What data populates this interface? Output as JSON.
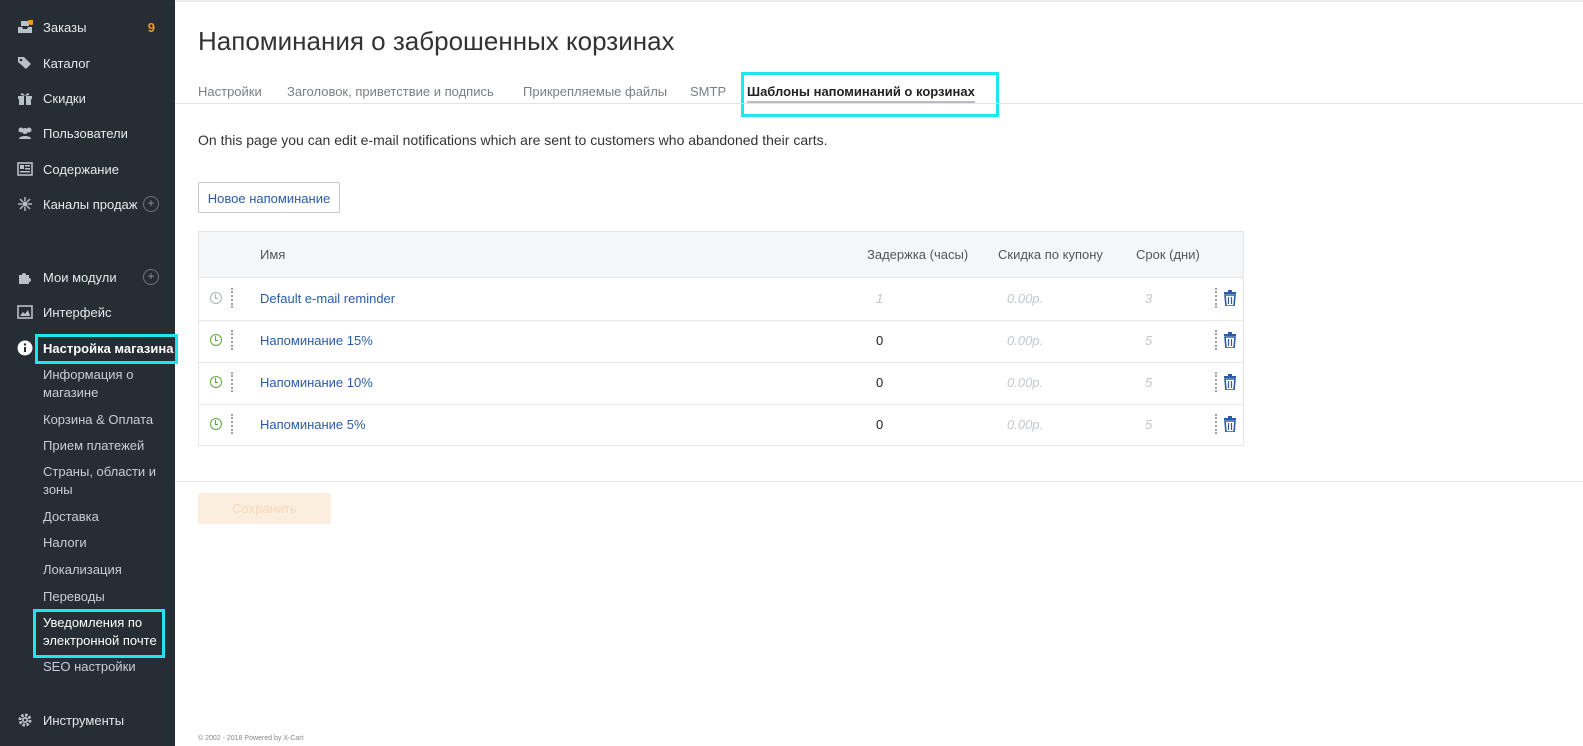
{
  "sidebar": {
    "items": [
      {
        "label": "Заказы",
        "icon": "orders-icon",
        "badge": "9"
      },
      {
        "label": "Каталог",
        "icon": "tags-icon"
      },
      {
        "label": "Скидки",
        "icon": "gift-icon"
      },
      {
        "label": "Пользователи",
        "icon": "users-icon"
      },
      {
        "label": "Содержание",
        "icon": "content-icon"
      },
      {
        "label": "Каналы продаж",
        "icon": "channels-icon",
        "plus": "+"
      },
      {
        "label": "Мои модули",
        "icon": "puzzle-icon",
        "plus": "+"
      },
      {
        "label": "Интерфейс",
        "icon": "image-icon"
      },
      {
        "label": "Настройка магазина",
        "icon": "info-icon"
      },
      {
        "label": "Инструменты",
        "icon": "gear-icon"
      }
    ],
    "subitems": [
      "Информация о магазине",
      "Корзина & Оплата",
      "Прием платежей",
      "Страны, области и зоны",
      "Доставка",
      "Налоги",
      "Локализация",
      "Переводы",
      "Уведомления по электронной почте",
      "SEO настройки"
    ]
  },
  "page": {
    "title": "Напоминания о заброшенных корзинах",
    "tabs": [
      "Настройки",
      "Заголовок, приветствие и подпись",
      "Прикрепляемые файлы",
      "SMTP",
      "Шаблоны напоминаний о корзинах"
    ],
    "description": "On this page you can edit e-mail notifications which are sent to customers who abandoned their carts.",
    "new_button": "Новое напоминание",
    "save_button": "Сохранить",
    "footer": "© 2002 - 2018 Powered by X-Cart"
  },
  "table": {
    "headers": [
      "Имя",
      "Задержка (часы)",
      "Скидка по купону",
      "Срок (дни)"
    ],
    "rows": [
      {
        "name": "Default e-mail reminder",
        "delay": "1",
        "discount": "0.00р.",
        "days": "3",
        "enabled": false
      },
      {
        "name": "Напоминание 15%",
        "delay": "0",
        "discount": "0.00р.",
        "days": "5",
        "enabled": true
      },
      {
        "name": "Напоминание 10%",
        "delay": "0",
        "discount": "0.00р.",
        "days": "5",
        "enabled": true
      },
      {
        "name": "Напоминание 5%",
        "delay": "0",
        "discount": "0.00р.",
        "days": "5",
        "enabled": true
      }
    ]
  },
  "colors": {
    "sidebar_bg": "#262d35",
    "link": "#2a5ca8",
    "badge": "#f39a1e",
    "highlight": "#1ee6ee",
    "enabled": "#5eab3c"
  }
}
